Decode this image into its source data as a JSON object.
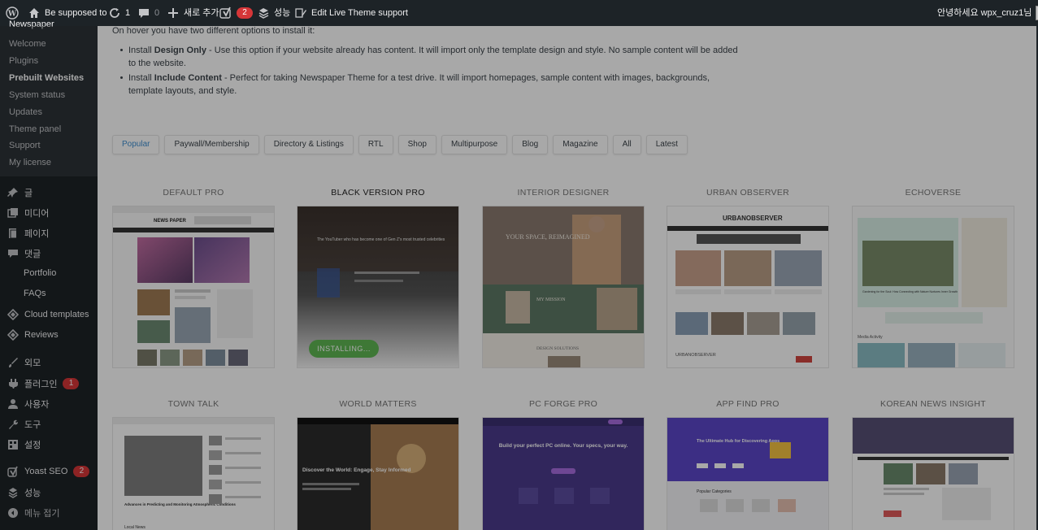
{
  "admin_bar": {
    "site_name": "Be supposed to",
    "updates_count": "1",
    "comments_count": "0",
    "new_label": "새로 추가",
    "yoast_badge": "2",
    "performance_label": "성능",
    "edit_live_label": "Edit Live",
    "theme_support_label": "Theme support",
    "greeting": "안녕하세요 wpx_cruz1님"
  },
  "sidebar": {
    "clipped_title": "Newspaper",
    "submenu": [
      "Welcome",
      "Plugins",
      "Prebuilt Websites",
      "System status",
      "Updates",
      "Theme panel",
      "Support",
      "My license"
    ],
    "menu": {
      "posts": "글",
      "media": "미디어",
      "pages": "페이지",
      "comments": "댓글",
      "portfolio": "Portfolio",
      "faqs": "FAQs",
      "cloud_templates": "Cloud templates",
      "reviews": "Reviews",
      "appearance": "외모",
      "plugins": "플러그인",
      "plugins_badge": "1",
      "users": "사용자",
      "tools": "도구",
      "settings": "설정",
      "yoast": "Yoast SEO",
      "yoast_badge": "2",
      "performance": "성능",
      "collapse": "메뉴 접기"
    }
  },
  "content": {
    "intro_text": "On hover you have two different options to install it:",
    "option1_prefix": "Install ",
    "option1_bold": "Design Only",
    "option1_text": " - Use this option if your website already has content. It will import only the template design and style. No sample content will be added to the website.",
    "option2_prefix": "Install ",
    "option2_bold": "Include Content",
    "option2_text": " - Perfect for taking Newspaper Theme for a test drive. It will import homepages, sample content with images, backgrounds, template layouts, and style.",
    "tabs": [
      "Popular",
      "Paywall/Membership",
      "Directory & Listings",
      "RTL",
      "Shop",
      "Multipurpose",
      "Blog",
      "Magazine",
      "All",
      "Latest"
    ],
    "active_tab": "Popular",
    "row1": [
      "DEFAULT PRO",
      "BLACK VERSION PRO",
      "INTERIOR DESIGNER",
      "URBAN OBSERVER",
      "ECHOVERSE"
    ],
    "row2": [
      "TOWN TALK",
      "WORLD MATTERS",
      "PC FORGE PRO",
      "APP FIND PRO",
      "KOREAN NEWS INSIGHT"
    ],
    "installing_label": "INSTALLING...",
    "thumb_texts": {
      "default_pro_logo": "NEWS PAPER",
      "interior_hero": "YOUR SPACE, REIMAGINED",
      "interior_mission": "MY MISSION",
      "interior_solutions": "DESIGN SOLUTIONS",
      "urban_logo": "URBANOBSERVER",
      "urban_sub": "URBANOBSERVER",
      "echo_headline": "Gardening for the Soul: How Connecting with Nature Nurtures Inner Growth",
      "echo_activity": "Media Activity",
      "world_hero": "Discover the World: Engage, Stay Informed",
      "pc_hero": "Build your perfect PC online. Your specs, your way.",
      "app_hero": "The Ultimate Hub for Discovering Apps",
      "app_categories": "Popular Categories",
      "town_headline": "Advances in Predicting and Monitoring Atmospheric Conditions",
      "town_local": "Local News",
      "black_headline": "The YouTuber who has become one of Gen Z's most trusted celebrities"
    }
  }
}
